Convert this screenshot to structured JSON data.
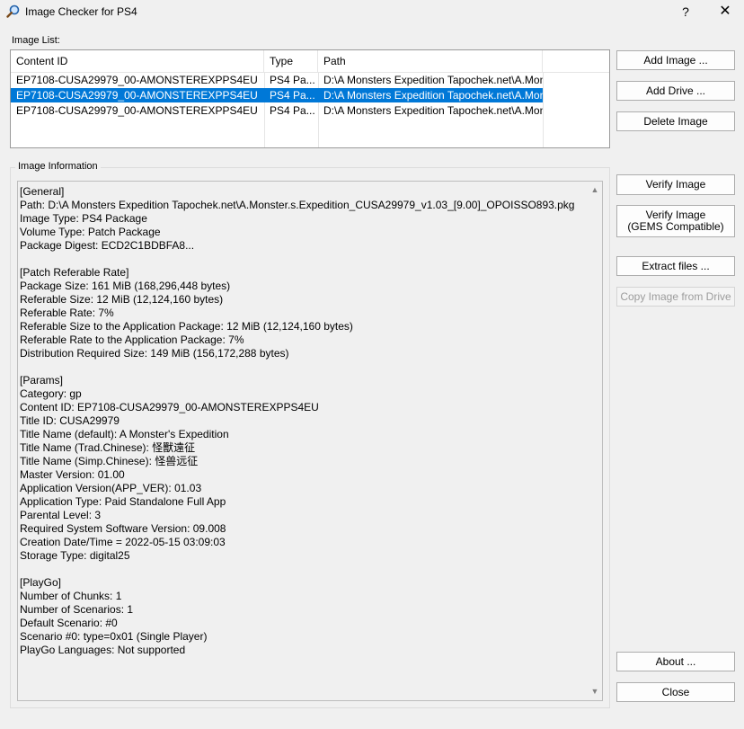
{
  "window": {
    "title": "Image Checker for PS4",
    "help_glyph": "?",
    "close_glyph": "✕"
  },
  "image_list": {
    "label": "Image List:",
    "columns": [
      "Content ID",
      "Type",
      "Path"
    ],
    "rows": [
      {
        "content_id": "EP7108-CUSA29979_00-AMONSTEREXPPS4EU",
        "type": "PS4 Pa...",
        "path": "D:\\A Monsters Expedition Tapochek.net\\A.Mon...",
        "selected": false
      },
      {
        "content_id": "EP7108-CUSA29979_00-AMONSTEREXPPS4EU",
        "type": "PS4 Pa...",
        "path": "D:\\A Monsters Expedition Tapochek.net\\A.Mon...",
        "selected": true
      },
      {
        "content_id": "EP7108-CUSA29979_00-AMONSTEREXPPS4EU",
        "type": "PS4 Pa...",
        "path": "D:\\A Monsters Expedition Tapochek.net\\A.Mon...",
        "selected": false
      }
    ]
  },
  "buttons": {
    "add_image": "Add Image ...",
    "add_drive": "Add Drive ...",
    "delete_image": "Delete Image",
    "verify_image": "Verify Image",
    "verify_gems_line1": "Verify Image",
    "verify_gems_line2": "(GEMS Compatible)",
    "extract_files": "Extract files ...",
    "copy_from_drive": "Copy Image from Drive",
    "about": "About ...",
    "close": "Close"
  },
  "image_information": {
    "label": "Image Information",
    "text": "[General]\nPath: D:\\A Monsters Expedition Tapochek.net\\A.Monster.s.Expedition_CUSA29979_v1.03_[9.00]_OPOISSO893.pkg\nImage Type: PS4 Package\nVolume Type: Patch Package\nPackage Digest: ECD2C1BDBFA8...\n\n[Patch Referable Rate]\nPackage Size: 161 MiB (168,296,448 bytes)\nReferable Size: 12 MiB (12,124,160 bytes)\nReferable Rate: 7%\nReferable Size to the Application Package: 12 MiB (12,124,160 bytes)\nReferable Rate to the Application Package: 7%\nDistribution Required Size: 149 MiB (156,172,288 bytes)\n\n[Params]\nCategory: gp\nContent ID: EP7108-CUSA29979_00-AMONSTEREXPPS4EU\nTitle ID: CUSA29979\nTitle Name (default): A Monster's Expedition\nTitle Name (Trad.Chinese): 怪獸遠征\nTitle Name (Simp.Chinese): 怪兽远征\nMaster Version: 01.00\nApplication Version(APP_VER): 01.03\nApplication Type: Paid Standalone Full App\nParental Level: 3\nRequired System Software Version: 09.008\nCreation Date/Time = 2022-05-15 03:09:03\nStorage Type: digital25\n\n[PlayGo]\nNumber of Chunks: 1\nNumber of Scenarios: 1\nDefault Scenario: #0\nScenario #0: type=0x01 (Single Player)\nPlayGo Languages: Not supported"
  },
  "colors": {
    "selection": "#0078d7",
    "window_bg": "#f0f0f0"
  }
}
